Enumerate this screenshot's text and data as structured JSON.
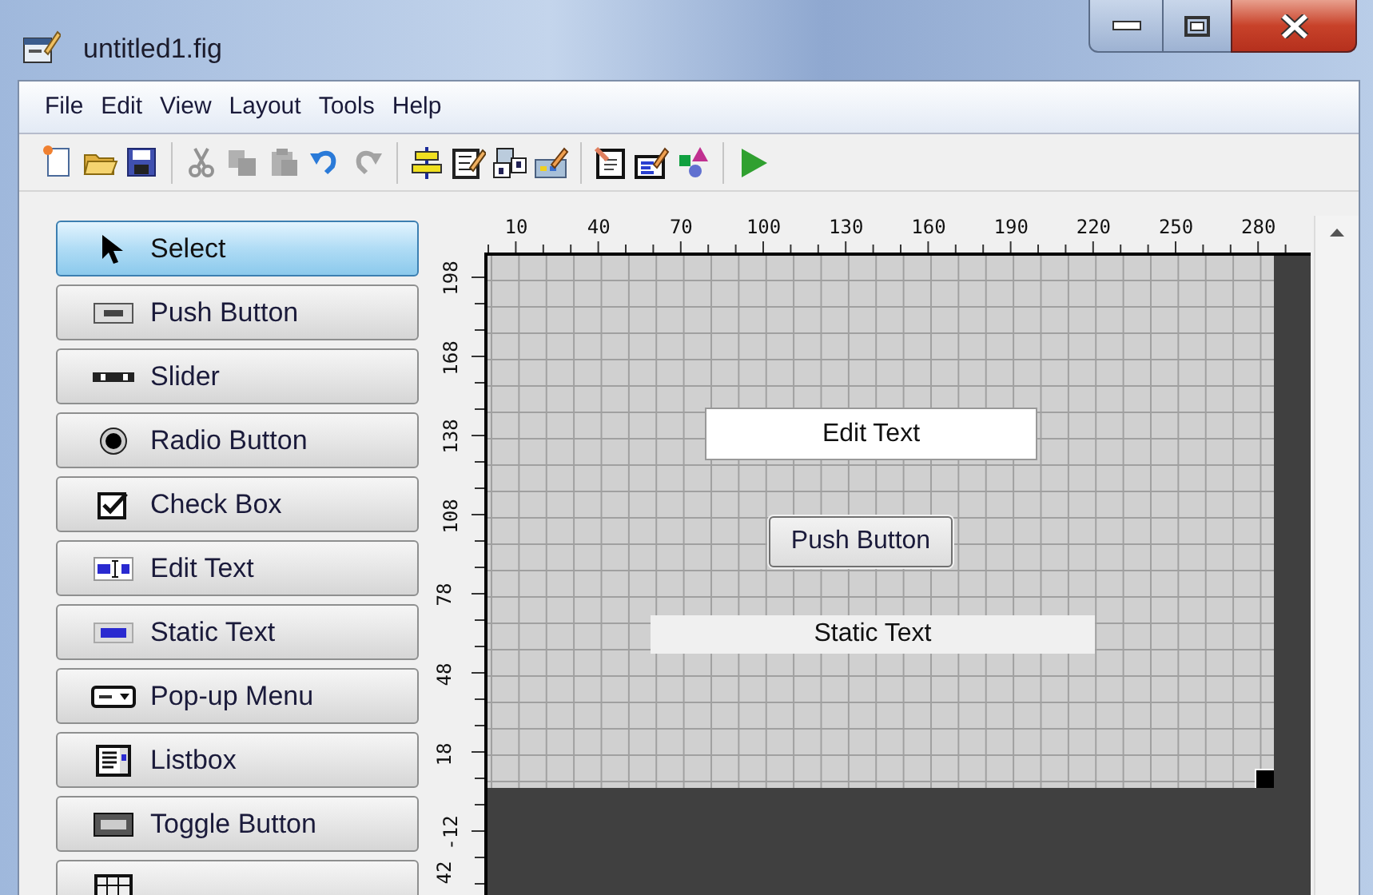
{
  "window": {
    "title": "untitled1.fig"
  },
  "menu": [
    "File",
    "Edit",
    "View",
    "Layout",
    "Tools",
    "Help"
  ],
  "toolbar": [
    {
      "kind": "new",
      "disabled": false
    },
    {
      "kind": "open",
      "disabled": false
    },
    {
      "kind": "save",
      "disabled": false
    },
    {
      "kind": "separator"
    },
    {
      "kind": "cut",
      "disabled": true
    },
    {
      "kind": "copy",
      "disabled": true
    },
    {
      "kind": "paste",
      "disabled": true
    },
    {
      "kind": "undo",
      "disabled": false
    },
    {
      "kind": "redo",
      "disabled": true
    },
    {
      "kind": "separator"
    },
    {
      "kind": "align",
      "disabled": false
    },
    {
      "kind": "menu_editor",
      "disabled": false
    },
    {
      "kind": "tab_order",
      "disabled": false
    },
    {
      "kind": "toolbar_editor",
      "disabled": false
    },
    {
      "kind": "separator"
    },
    {
      "kind": "editor",
      "disabled": false
    },
    {
      "kind": "inspector",
      "disabled": false
    },
    {
      "kind": "browser",
      "disabled": false
    },
    {
      "kind": "separator"
    },
    {
      "kind": "run",
      "disabled": false
    }
  ],
  "palette": [
    {
      "label": "Select",
      "kind": "select",
      "selected": true
    },
    {
      "label": "Push Button",
      "kind": "push",
      "selected": false
    },
    {
      "label": "Slider",
      "kind": "slider",
      "selected": false
    },
    {
      "label": "Radio Button",
      "kind": "radio",
      "selected": false
    },
    {
      "label": "Check Box",
      "kind": "check",
      "selected": false
    },
    {
      "label": "Edit Text",
      "kind": "edit",
      "selected": false
    },
    {
      "label": "Static Text",
      "kind": "static",
      "selected": false
    },
    {
      "label": "Pop-up Menu",
      "kind": "popup",
      "selected": false
    },
    {
      "label": "Listbox",
      "kind": "listbox",
      "selected": false
    },
    {
      "label": "Toggle Button",
      "kind": "toggle",
      "selected": false
    },
    {
      "kind": "table",
      "selected": false
    }
  ],
  "ruler": {
    "x_labels": [
      "10",
      "40",
      "70",
      "100",
      "130",
      "160",
      "190",
      "220",
      "250",
      "280"
    ],
    "y_labels": [
      "198",
      "168",
      "138",
      "108",
      "78",
      "48",
      "18",
      "-12",
      "42"
    ]
  },
  "canvas": {
    "components": [
      {
        "kind": "edit_text",
        "text": "Edit Text"
      },
      {
        "kind": "push_button",
        "text": "Push Button"
      },
      {
        "kind": "static_text",
        "text": "Static Text"
      }
    ]
  }
}
